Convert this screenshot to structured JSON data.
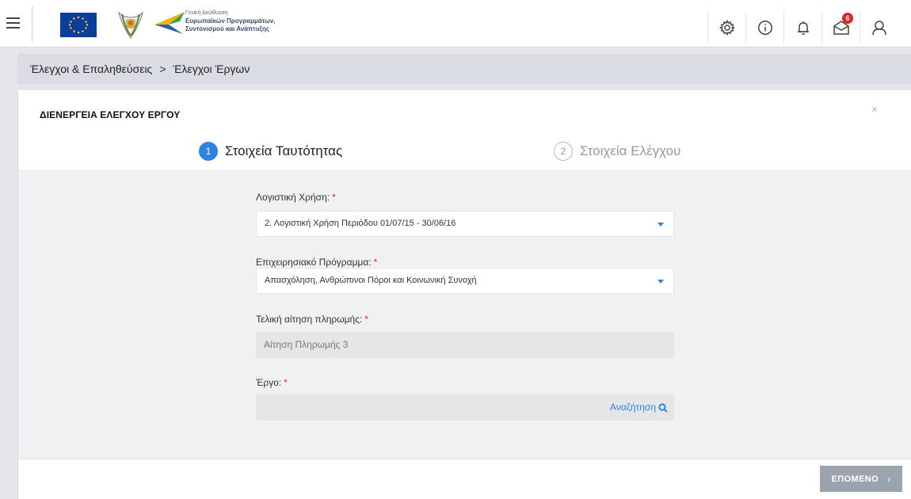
{
  "brand": {
    "line1": "Γενική Διεύθυνση",
    "line2": "Ευρωπαϊκών Προγραμμάτων,",
    "line3": "Συντονισμού και Ανάπτυξης"
  },
  "topbar": {
    "icons": [
      "settings-icon",
      "info-icon",
      "bell-icon",
      "envelope-icon",
      "user-icon"
    ],
    "messages_badge": "6"
  },
  "breadcrumb": {
    "items": [
      "Έλεγχοι & Επαληθεύσεις",
      "Έλεγχοι Έργων"
    ],
    "separator": ">"
  },
  "dialog": {
    "title": "ΔΙΕΝΕΡΓΕΙΑ ΕΛΕΓΧΟΥ ΕΡΓΟΥ",
    "close": "×",
    "steps": [
      {
        "number": "1",
        "label": "Στοιχεία Ταυτότητας",
        "active": true
      },
      {
        "number": "2",
        "label": "Στοιχεία Ελέγχου",
        "active": false
      }
    ],
    "fields": {
      "fiscal_year": {
        "label": "Λογιστική Χρήση:",
        "required": "*",
        "value": "2. Λογιστική Χρήση Περιόδου 01/07/15 - 30/06/16"
      },
      "program": {
        "label": "Επιχειρησιακό Πρόγραμμα:",
        "required": "*",
        "value": "Απασχόληση, Ανθρώπινοι Πόροι και Κοινωνική Συνοχή"
      },
      "payment_request": {
        "label": "Τελική αίτηση πληρωμής:",
        "required": "*",
        "value": "Αίτηση Πληρωμής 3"
      },
      "project": {
        "label": "Έργο:",
        "required": "*",
        "search_label": "Αναζήτηση"
      }
    },
    "next_button": "ΕΠΟΜΕΝΟ",
    "next_chevron": "›"
  },
  "colors": {
    "accent": "#2f83e0",
    "required": "#e32727",
    "badge": "#e02323",
    "button_disabled": "#9ba3ad"
  }
}
